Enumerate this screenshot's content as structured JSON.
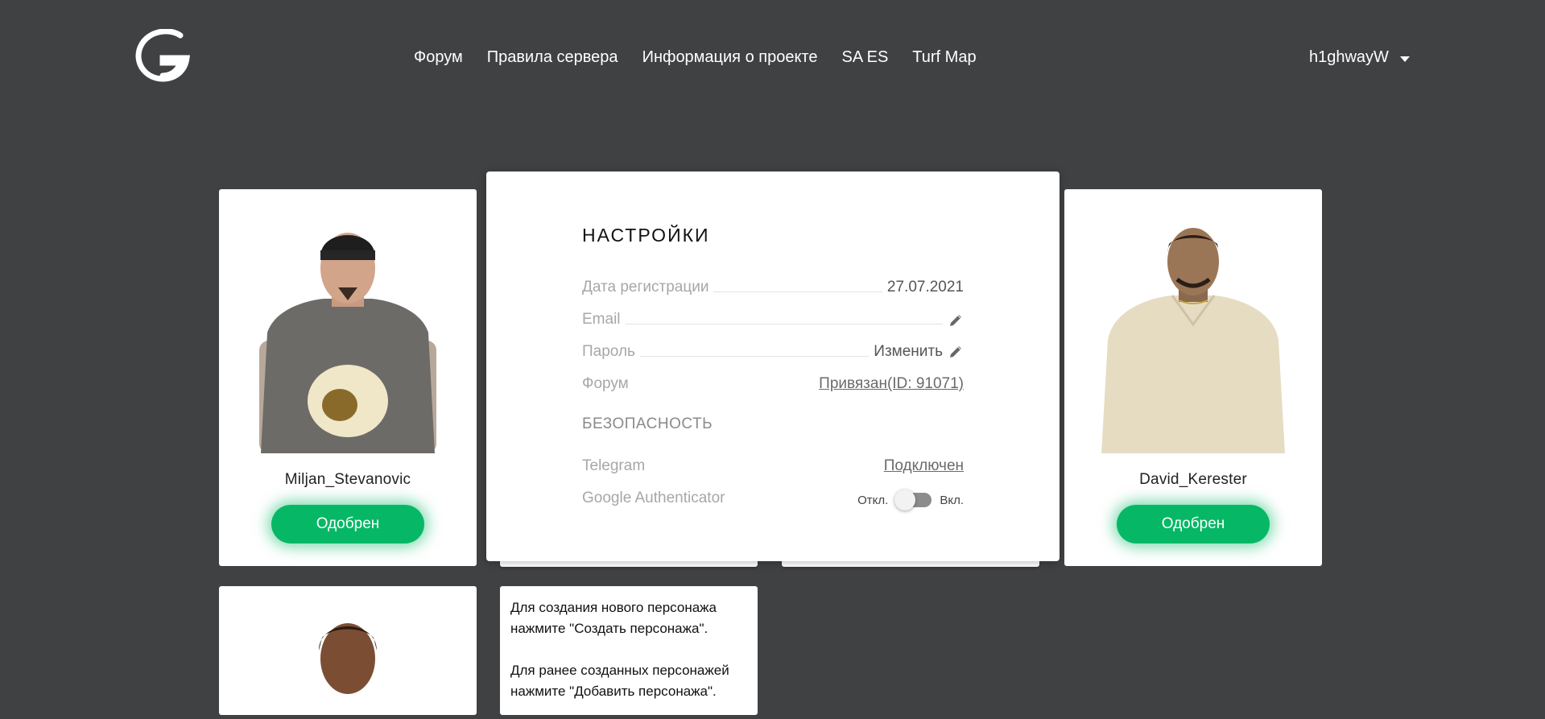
{
  "header": {
    "nav": [
      "Форум",
      "Правила сервера",
      "Информация о проекте",
      "SA ES",
      "Turf Map"
    ],
    "username": "h1ghwayW"
  },
  "characters": [
    {
      "name": "Miljan_Stevanovic",
      "status": "Одобрен"
    },
    {
      "name": "David_Kerester",
      "status": "Одобрен"
    }
  ],
  "settings": {
    "title": "НАСТРОЙКИ",
    "registration_label": "Дата регистрации",
    "registration_value": "27.07.2021",
    "email_label": "Email",
    "password_label": "Пароль",
    "password_action": "Изменить",
    "forum_label": "Форум",
    "forum_value": "Привязан(ID: 91071)",
    "security_title": "БЕЗОПАСНОСТЬ",
    "telegram_label": "Telegram",
    "telegram_value": "Подключен",
    "ga_label": "Google Authenticator",
    "ga_off": "Откл.",
    "ga_on": "Вкл."
  },
  "info": {
    "line1": "Для создания нового персонажа нажмите \"Создать персонажа\".",
    "line2": "Для ранее созданных персонажей нажмите \"Добавить персонажа\"."
  },
  "colors": {
    "background": "#404143",
    "accent_green": "#06b865"
  }
}
